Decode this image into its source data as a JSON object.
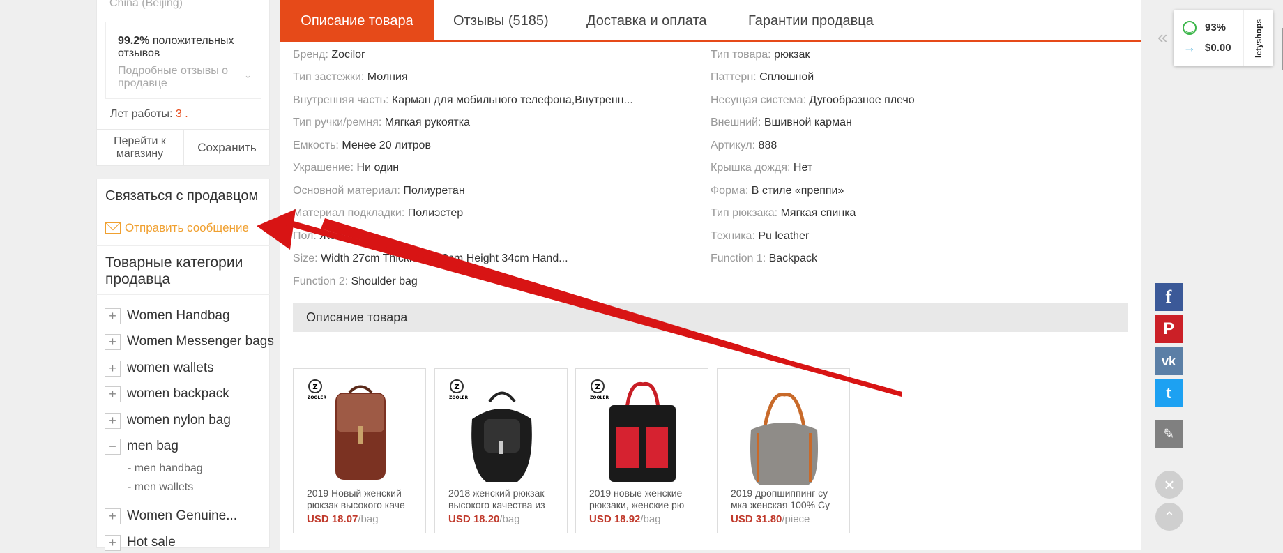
{
  "seller": {
    "location": "China (Beijing)",
    "feedback_pct": "99.2%",
    "feedback_label": "положительных отзывов",
    "detail_link": "Подробные отзывы о продавце",
    "years_label": "Лет работы:",
    "years_value": "3",
    "years_suffix": ".",
    "goto_store": "Перейти к магазину",
    "save": "Сохранить"
  },
  "contact": {
    "title": "Связаться с продавцом",
    "send_message": "Отправить сообщение"
  },
  "categories": {
    "title": "Товарные категории продавца",
    "items": [
      {
        "label": "Women Handbag",
        "sign": "+"
      },
      {
        "label": "Women Messenger bags",
        "sign": "+"
      },
      {
        "label": "women wallets",
        "sign": "+"
      },
      {
        "label": "women backpack",
        "sign": "+"
      },
      {
        "label": "women nylon bag",
        "sign": "+"
      },
      {
        "label": "men bag",
        "sign": "−"
      },
      {
        "label": "Women Genuine...",
        "sign": "+"
      },
      {
        "label": "Hot sale",
        "sign": "+"
      }
    ],
    "subitems": [
      "- men handbag",
      "- men wallets"
    ]
  },
  "tabs": [
    {
      "label": "Описание товара",
      "active": true
    },
    {
      "label": "Отзывы (5185)",
      "active": false
    },
    {
      "label": "Доставка и оплата",
      "active": false
    },
    {
      "label": "Гарантии продавца",
      "active": false
    }
  ],
  "specs_left": [
    {
      "label": "Бренд:",
      "value": "Zocilor"
    },
    {
      "label": "Тип застежки:",
      "value": "Молния"
    },
    {
      "label": "Внутренняя часть:",
      "value": "Карман для мобильного телефона,Внутренн..."
    },
    {
      "label": "Тип ручки/ремня:",
      "value": "Мягкая рукоятка"
    },
    {
      "label": "Емкость:",
      "value": "Менее 20 литров"
    },
    {
      "label": "Украшение:",
      "value": "Ни один"
    },
    {
      "label": "Основной материал:",
      "value": "Полиуретан"
    },
    {
      "label": "Материал подкладки:",
      "value": "Полиэстер"
    },
    {
      "label": "Пол:",
      "value": "Женщина"
    },
    {
      "label": "Size:",
      "value": "Width 27cm Thickness 13cm Height 34cm Hand..."
    },
    {
      "label": "Function 2:",
      "value": "Shoulder bag"
    }
  ],
  "specs_right": [
    {
      "label": "Тип товара:",
      "value": "рюкзак"
    },
    {
      "label": "Паттерн:",
      "value": "Сплошной"
    },
    {
      "label": "Несущая система:",
      "value": "Дугообразное плечо"
    },
    {
      "label": "Внешний:",
      "value": "Вшивной карман"
    },
    {
      "label": "Артикул:",
      "value": "888"
    },
    {
      "label": "Крышка дождя:",
      "value": "Нет"
    },
    {
      "label": "Форма:",
      "value": "В стиле «преппи»"
    },
    {
      "label": "Тип рюкзака:",
      "value": "Мягкая спинка"
    },
    {
      "label": "Техника:",
      "value": "Pu leather"
    },
    {
      "label": "Function 1:",
      "value": "Backpack"
    }
  ],
  "description_header": "Описание товара",
  "products": [
    {
      "line1": "2019 Новый женский",
      "line2": "рюкзак высокого каче",
      "price": "USD 18.07",
      "unit": "/bag"
    },
    {
      "line1": "2018 женский рюкзак",
      "line2": "высокого качества из",
      "price": "USD 18.20",
      "unit": "/bag"
    },
    {
      "line1": "2019 новые женские",
      "line2": "рюкзаки, женские рю",
      "price": "USD 18.92",
      "unit": "/bag"
    },
    {
      "line1": "2019 дропшиппинг су",
      "line2": "мка женская 100% Су",
      "price": "USD 31.80",
      "unit": "/piece"
    }
  ],
  "brand_mark": "ZOOLER",
  "letyshops": {
    "pct": "93%",
    "amount": "$0.00",
    "brand": "letyshops"
  },
  "social": {
    "facebook": "f",
    "pinterest": "P",
    "vk": "vk",
    "twitter": "t"
  },
  "colors": {
    "accent": "#e64a19",
    "price": "#c0392b",
    "message": "#f0a030",
    "arrow": "#d81414"
  }
}
